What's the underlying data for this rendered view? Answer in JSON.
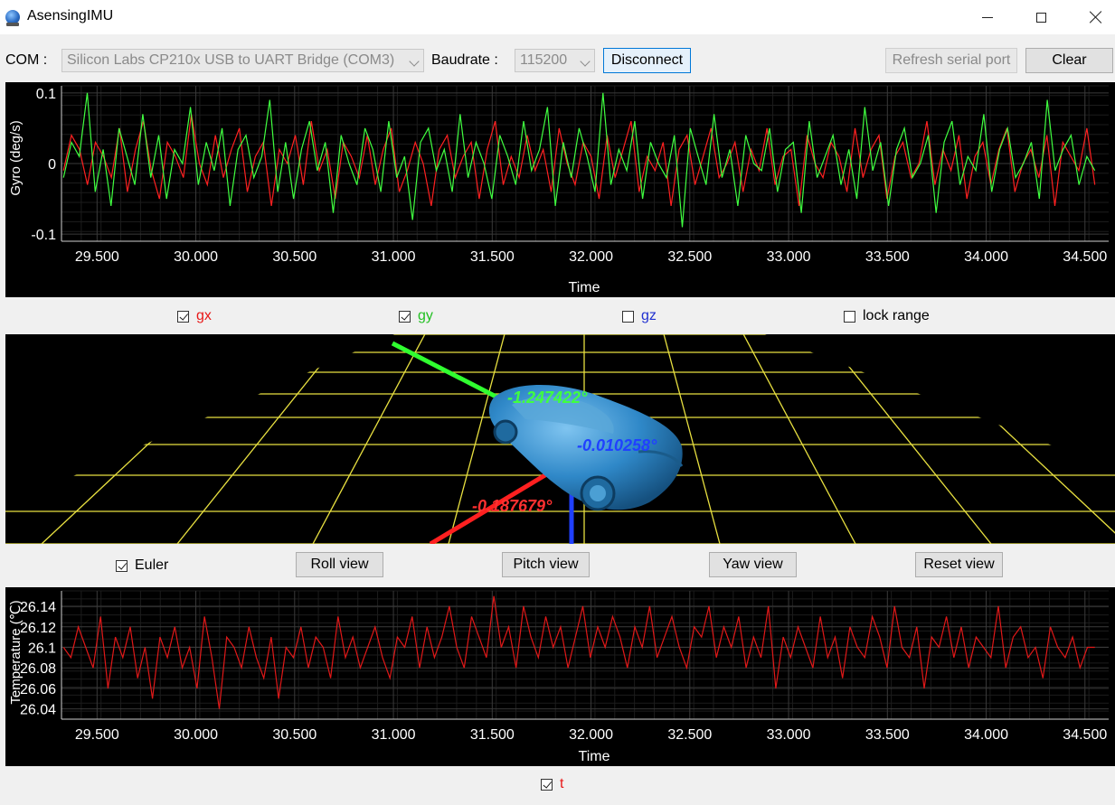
{
  "window": {
    "title": "AsensingIMU",
    "icon": "globe-app-icon"
  },
  "toolbar": {
    "com_label": "COM :",
    "com_value": "Silicon Labs CP210x USB to UART Bridge (COM3)",
    "baud_label": "Baudrate :",
    "baud_value": "115200",
    "disconnect_label": "Disconnect",
    "refresh_label": "Refresh serial port",
    "clear_label": "Clear"
  },
  "gyro_chart": {
    "chart_data": {
      "type": "line",
      "ylabel": "Gyro (deg/s)",
      "xlabel": "Time",
      "xlim": [
        29.32,
        34.62
      ],
      "ylim": [
        -0.11,
        0.11
      ],
      "x_ticks": [
        "29.500",
        "30.000",
        "30.500",
        "31.000",
        "31.500",
        "32.000",
        "32.500",
        "33.000",
        "33.500",
        "34.000",
        "34.500"
      ],
      "x_tick_values": [
        29.5,
        30.0,
        30.5,
        31.0,
        31.5,
        32.0,
        32.5,
        33.0,
        33.5,
        34.0,
        34.5
      ],
      "y_ticks": [
        "0.1",
        "0",
        "-0.1"
      ],
      "y_tick_values": [
        0.1,
        0,
        -0.1
      ],
      "x_start": 29.33,
      "x_end": 34.55,
      "series": [
        {
          "name": "gx",
          "color": "#ff2020",
          "values": [
            -0.01,
            0.04,
            0.02,
            -0.03,
            0.03,
            0.01,
            -0.02,
            0.05,
            -0.04,
            0.02,
            0.06,
            -0.01,
            -0.05,
            0.03,
            0.01,
            -0.02,
            0.07,
            0.0,
            -0.03,
            0.04,
            -0.02,
            0.02,
            0.05,
            -0.04,
            0.01,
            0.03,
            -0.06,
            0.02,
            0.0,
            0.04,
            -0.03,
            0.06,
            -0.01,
            0.02,
            -0.05,
            0.03,
            0.01,
            -0.02,
            0.04,
            -0.03,
            0.02,
            0.05,
            -0.04,
            -0.01,
            0.03,
            0.0,
            -0.06,
            0.02,
            0.04,
            -0.02,
            0.01,
            0.03,
            -0.05,
            0.02,
            0.06,
            -0.03,
            0.01,
            -0.02,
            0.04,
            -0.01,
            0.02,
            -0.04,
            0.05,
            0.0,
            -0.03,
            0.03,
            0.01,
            -0.05,
            0.04,
            -0.02,
            0.02,
            0.06,
            -0.04,
            0.01,
            -0.01,
            0.03,
            -0.06,
            0.02,
            0.04,
            -0.03,
            0.01,
            0.05,
            -0.02,
            0.0,
            0.03,
            -0.04,
            0.02,
            -0.01,
            0.05,
            -0.03,
            0.01,
            0.02,
            -0.06,
            0.04,
            0.0,
            -0.02,
            0.03,
            0.01,
            -0.04,
            0.05,
            -0.02,
            0.02,
            0.04,
            -0.05,
            0.01,
            0.03,
            -0.02,
            0.0,
            0.06,
            -0.03,
            0.02,
            -0.01,
            0.04,
            -0.05,
            0.01,
            0.03,
            -0.03,
            0.02,
            0.05,
            -0.04,
            0.0,
            0.02,
            -0.02,
            0.04,
            -0.06,
            0.03,
            0.01,
            -0.01,
            0.05,
            -0.03
          ]
        },
        {
          "name": "gy",
          "color": "#40ff40",
          "values": [
            -0.02,
            0.03,
            0.01,
            0.1,
            -0.04,
            0.02,
            -0.06,
            0.05,
            0.01,
            -0.03,
            0.07,
            -0.02,
            0.04,
            -0.05,
            0.02,
            0.0,
            0.08,
            -0.03,
            0.03,
            -0.01,
            0.05,
            -0.06,
            0.02,
            0.04,
            -0.02,
            0.01,
            0.09,
            -0.04,
            0.03,
            -0.05,
            0.02,
            0.06,
            -0.01,
            0.03,
            -0.07,
            0.04,
            0.0,
            -0.03,
            0.05,
            0.02,
            -0.04,
            0.06,
            -0.02,
            0.01,
            -0.08,
            0.03,
            0.05,
            -0.01,
            0.02,
            -0.04,
            0.07,
            -0.02,
            0.03,
            0.0,
            -0.05,
            0.04,
            0.01,
            -0.03,
            0.06,
            -0.01,
            0.02,
            0.08,
            -0.06,
            0.03,
            -0.02,
            0.05,
            0.01,
            -0.04,
            0.1,
            -0.03,
            0.02,
            -0.01,
            0.06,
            -0.05,
            0.03,
            0.0,
            -0.02,
            0.04,
            -0.09,
            0.05,
            0.01,
            -0.03,
            0.07,
            -0.02,
            0.02,
            -0.06,
            0.04,
            0.0,
            -0.01,
            0.05,
            -0.04,
            0.02,
            0.03,
            -0.07,
            0.06,
            -0.02,
            0.01,
            0.04,
            -0.03,
            0.02,
            -0.05,
            0.08,
            -0.01,
            0.03,
            -0.06,
            0.02,
            0.05,
            -0.02,
            0.0,
            0.04,
            -0.07,
            0.03,
            0.06,
            -0.03,
            0.01,
            -0.01,
            0.07,
            -0.04,
            0.02,
            0.05,
            -0.02,
            0.0,
            0.03,
            -0.05,
            0.09,
            -0.01,
            0.02,
            0.04,
            -0.03,
            0.01,
            -0.01
          ]
        }
      ]
    }
  },
  "gyro_toggles": [
    {
      "label": "gx",
      "checked": true,
      "color": "#e81818"
    },
    {
      "label": "gy",
      "checked": true,
      "color": "#22c022"
    },
    {
      "label": "gz",
      "checked": false,
      "color": "#2030d0"
    },
    {
      "label": "lock range",
      "checked": false,
      "color": "#000000"
    }
  ],
  "scene": {
    "roll_value": "-1.247422°",
    "pitch_value": "-0.187679°",
    "yaw_value": "-0.010258°",
    "grid_color": "#e8e040",
    "car_color": "#2f88c8"
  },
  "view_controls": {
    "euler_label": "Euler",
    "euler_checked": true,
    "roll_view": "Roll view",
    "pitch_view": "Pitch view",
    "yaw_view": "Yaw view",
    "reset_view": "Reset view"
  },
  "temp_chart": {
    "chart_data": {
      "type": "line",
      "ylabel": "Temperature (℃)",
      "xlabel": "Time",
      "xlim": [
        29.32,
        34.62
      ],
      "ylim": [
        26.03,
        26.155
      ],
      "x_ticks": [
        "29.500",
        "30.000",
        "30.500",
        "31.000",
        "31.500",
        "32.000",
        "32.500",
        "33.000",
        "33.500",
        "34.000",
        "34.500"
      ],
      "x_tick_values": [
        29.5,
        30.0,
        30.5,
        31.0,
        31.5,
        32.0,
        32.5,
        33.0,
        33.5,
        34.0,
        34.5
      ],
      "y_ticks": [
        "26.14",
        "26.12",
        "26.1",
        "26.08",
        "26.06",
        "26.04"
      ],
      "y_tick_values": [
        26.14,
        26.12,
        26.1,
        26.08,
        26.06,
        26.04
      ],
      "x_start": 29.33,
      "x_end": 34.55,
      "series": [
        {
          "name": "t",
          "color": "#e01818",
          "values": [
            26.1,
            26.09,
            26.12,
            26.1,
            26.08,
            26.13,
            26.06,
            26.11,
            26.09,
            26.12,
            26.07,
            26.1,
            26.05,
            26.11,
            26.09,
            26.12,
            26.08,
            26.1,
            26.06,
            26.13,
            26.09,
            26.04,
            26.11,
            26.1,
            26.08,
            26.12,
            26.09,
            26.07,
            26.11,
            26.05,
            26.1,
            26.09,
            26.12,
            26.08,
            26.11,
            26.1,
            26.07,
            26.13,
            26.09,
            26.11,
            26.08,
            26.1,
            26.12,
            26.09,
            26.07,
            26.11,
            26.1,
            26.13,
            26.08,
            26.12,
            26.09,
            26.11,
            26.14,
            26.1,
            26.08,
            26.13,
            26.11,
            26.09,
            26.15,
            26.1,
            26.12,
            26.08,
            26.14,
            26.11,
            26.09,
            26.13,
            26.1,
            26.12,
            26.08,
            26.11,
            26.14,
            26.09,
            26.12,
            26.1,
            26.13,
            26.11,
            26.08,
            26.12,
            26.1,
            26.14,
            26.09,
            26.11,
            26.13,
            26.1,
            26.08,
            26.12,
            26.11,
            26.14,
            26.09,
            26.12,
            26.1,
            26.13,
            26.08,
            26.11,
            26.09,
            26.14,
            26.06,
            26.11,
            26.09,
            26.12,
            26.1,
            26.08,
            26.13,
            26.09,
            26.11,
            26.07,
            26.12,
            26.1,
            26.09,
            26.13,
            26.11,
            26.08,
            26.14,
            26.1,
            26.09,
            26.12,
            26.06,
            26.11,
            26.1,
            26.13,
            26.09,
            26.12,
            26.08,
            26.11,
            26.1,
            26.09,
            26.14,
            26.08,
            26.11,
            26.12,
            26.09,
            26.1,
            26.07,
            26.12,
            26.1,
            26.09,
            26.11,
            26.08,
            26.1,
            26.1
          ]
        }
      ]
    }
  },
  "temp_toggle": {
    "label": "t",
    "checked": true,
    "color": "#e81818"
  }
}
